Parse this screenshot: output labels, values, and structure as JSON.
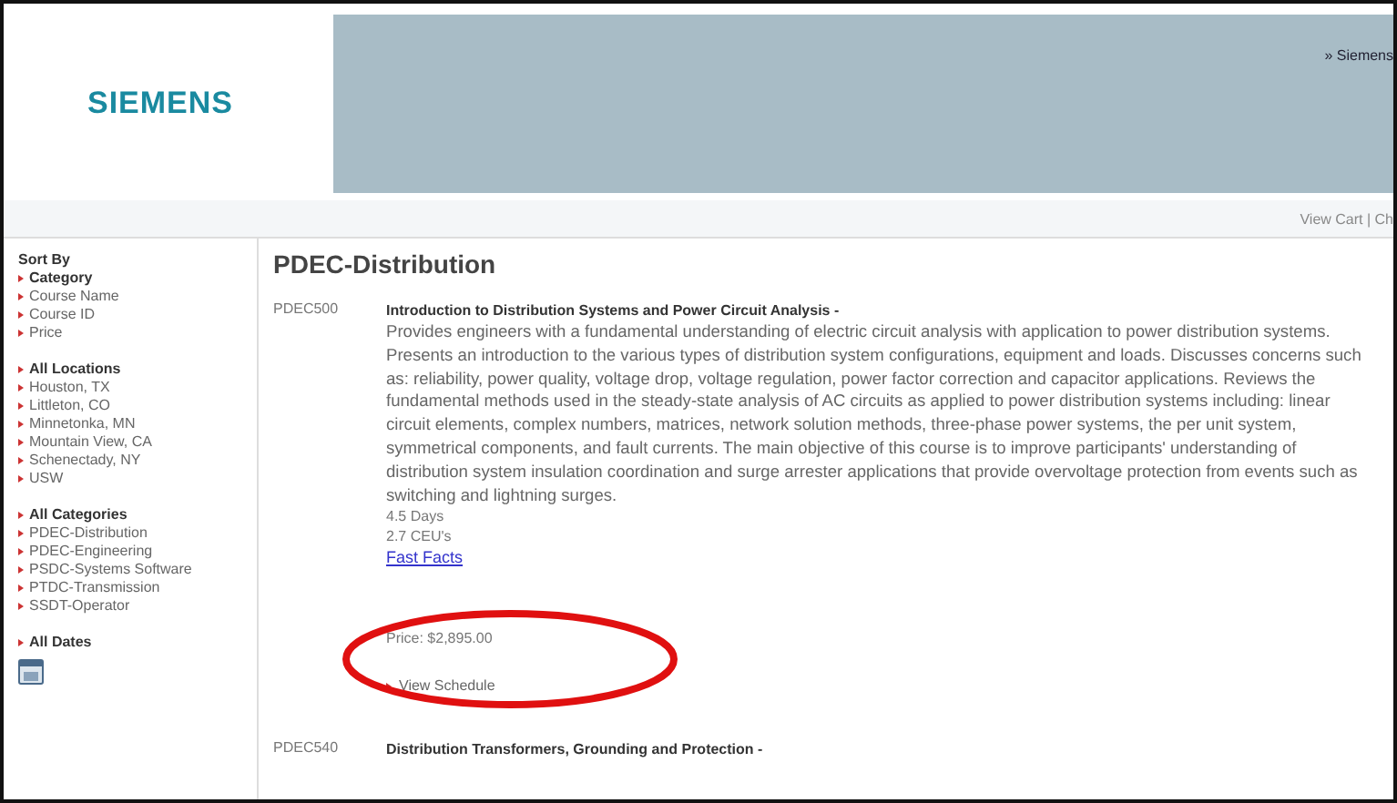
{
  "header": {
    "logo": "SIEMENS",
    "top_link": "» Siemens",
    "cart_link": "View Cart | Ch"
  },
  "sidebar": {
    "title": "Sort By",
    "groups": [
      {
        "items": [
          {
            "label": "Category",
            "selected": true
          },
          {
            "label": "Course Name",
            "selected": false
          },
          {
            "label": "Course ID",
            "selected": false
          },
          {
            "label": "Price",
            "selected": false
          }
        ]
      },
      {
        "items": [
          {
            "label": "All Locations",
            "selected": true
          },
          {
            "label": "Houston, TX",
            "selected": false
          },
          {
            "label": "Littleton, CO",
            "selected": false
          },
          {
            "label": "Minnetonka, MN",
            "selected": false
          },
          {
            "label": "Mountain View, CA",
            "selected": false
          },
          {
            "label": "Schenectady, NY",
            "selected": false
          },
          {
            "label": "USW",
            "selected": false
          }
        ]
      },
      {
        "items": [
          {
            "label": "All Categories",
            "selected": true
          },
          {
            "label": "PDEC-Distribution",
            "selected": false
          },
          {
            "label": "PDEC-Engineering",
            "selected": false
          },
          {
            "label": "PSDC-Systems Software",
            "selected": false
          },
          {
            "label": "PTDC-Transmission",
            "selected": false
          },
          {
            "label": "SSDT-Operator",
            "selected": false
          }
        ]
      },
      {
        "kind": "dates",
        "items": [
          {
            "label": "All Dates",
            "selected": true
          }
        ]
      }
    ]
  },
  "main": {
    "title": "PDEC-Distribution",
    "courses": [
      {
        "id": "PDEC500",
        "title": "Introduction to Distribution Systems and Power Circuit Analysis -",
        "description": "Provides engineers with a fundamental understanding of electric circuit analysis with application to power distribution systems. Presents an introduction to the various types of distribution system configurations, equipment and loads. Discusses concerns such as: reliability, power quality, voltage drop, voltage regulation, power factor correction and capacitor applications. Reviews the fundamental methods used in the steady-state analysis of AC circuits as applied to power distribution systems including: linear circuit elements, complex numbers, matrices, network solution methods, three-phase power systems, the per unit system, symmetrical components, and fault currents. The main objective of this course is to improve participants' understanding of distribution system insulation coordination and surge arrester applications that provide overvoltage protection from events such as switching and lightning surges.",
        "duration": "4.5 Days",
        "ceus": "2.7 CEU's",
        "link": "Fast Facts",
        "price": "Price: $2,895.00",
        "schedule": "View Schedule"
      },
      {
        "id": "PDEC540",
        "title": "Distribution Transformers, Grounding and Protection -"
      }
    ]
  }
}
